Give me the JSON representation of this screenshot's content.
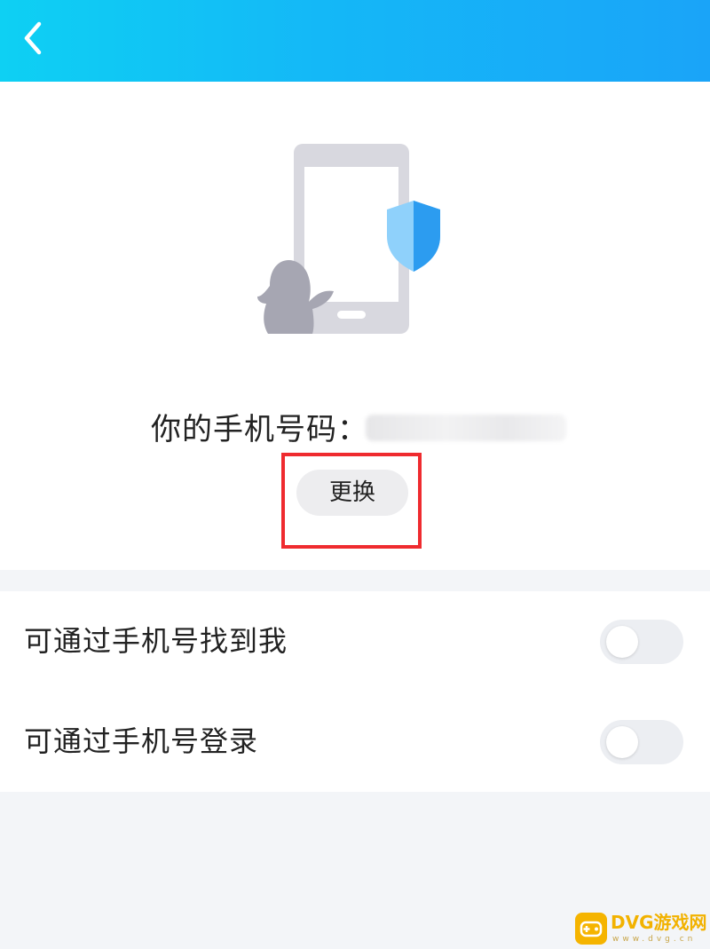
{
  "header": {
    "back_icon": "chevron-left-icon"
  },
  "hero": {
    "illustration": "phone-with-shield-and-penguin-illustration",
    "phone_label": "你的手机号码：",
    "phone_value": "",
    "change_button_label": "更换"
  },
  "settings": {
    "items": [
      {
        "label": "可通过手机号找到我",
        "enabled": false
      },
      {
        "label": "可通过手机号登录",
        "enabled": false
      }
    ]
  },
  "watermark": {
    "brand": "DVG游戏网",
    "sub": "www.dvg.cn"
  },
  "colors": {
    "header_start": "#0ed0f3",
    "header_end": "#1aa4f8",
    "highlight": "#ef2b2f",
    "toggle_off": "#eceef2",
    "shield": "#2c9cf0"
  }
}
